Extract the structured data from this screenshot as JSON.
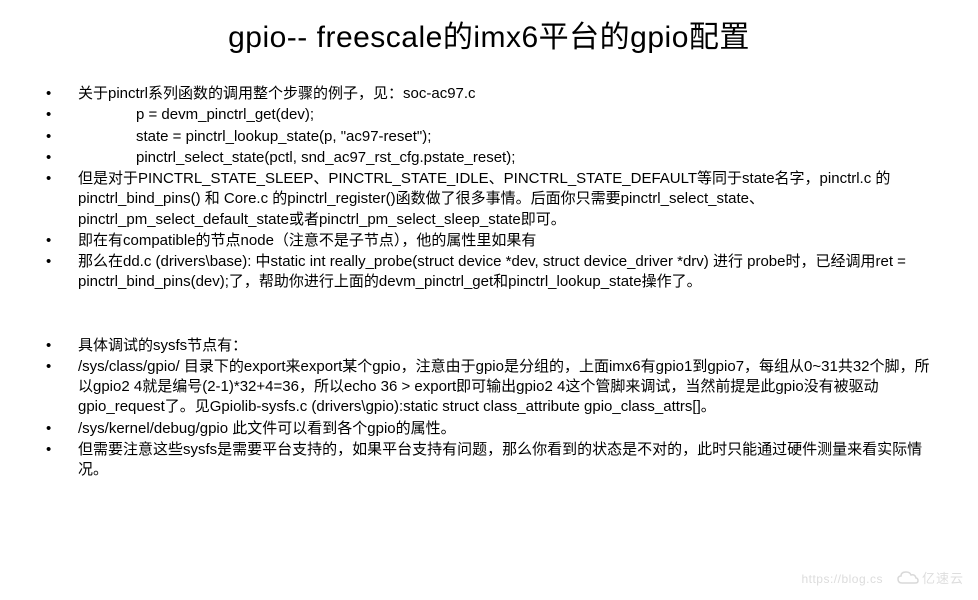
{
  "title": "gpio-- freescale的imx6平台的gpio配置",
  "bullets": [
    {
      "text": "关于pinctrl系列函数的调用整个步骤的例子，见：soc-ac97.c",
      "indent": false
    },
    {
      "text": "p = devm_pinctrl_get(dev);",
      "indent": true
    },
    {
      "text": "state = pinctrl_lookup_state(p, \"ac97-reset\");",
      "indent": true
    },
    {
      "text": "pinctrl_select_state(pctl, snd_ac97_rst_cfg.pstate_reset);",
      "indent": true
    },
    {
      "text": "但是对于PINCTRL_STATE_SLEEP、PINCTRL_STATE_IDLE、PINCTRL_STATE_DEFAULT等同于state名字，pinctrl.c 的pinctrl_bind_pins() 和 Core.c 的pinctrl_register()函数做了很多事情。后面你只需要pinctrl_select_state、pinctrl_pm_select_default_state或者pinctrl_pm_select_sleep_state即可。",
      "indent": false
    },
    {
      "text": "即在有compatible的节点node（注意不是子节点），他的属性里如果有",
      "indent": false
    },
    {
      "text": "那么在dd.c (drivers\\base):           中static int really_probe(struct device *dev, struct device_driver *drv) 进行 probe时，已经调用ret = pinctrl_bind_pins(dev);了，帮助你进行上面的devm_pinctrl_get和pinctrl_lookup_state操作了。",
      "indent": false
    }
  ],
  "bullets2": [
    {
      "text": "具体调试的sysfs节点有：",
      "indent": false
    },
    {
      "text": "/sys/class/gpio/ 目录下的export来export某个gpio，注意由于gpio是分组的，上面imx6有gpio1到gpio7，每组从0~31共32个脚，所以gpio2 4就是编号(2-1)*32+4=36，所以echo 36 > export即可输出gpio2 4这个管脚来调试，当然前提是此gpio没有被驱动gpio_request了。见Gpiolib-sysfs.c (drivers\\gpio):static struct class_attribute gpio_class_attrs[]。",
      "indent": false
    },
    {
      "text": "/sys/kernel/debug/gpio 此文件可以看到各个gpio的属性。",
      "indent": false
    },
    {
      "text": "但需要注意这些sysfs是需要平台支持的，如果平台支持有问题，那么你看到的状态是不对的，此时只能通过硬件测量来看实际情况。",
      "indent": false
    }
  ],
  "watermark": {
    "url": "https://blog.cs",
    "brand": "亿速云"
  }
}
